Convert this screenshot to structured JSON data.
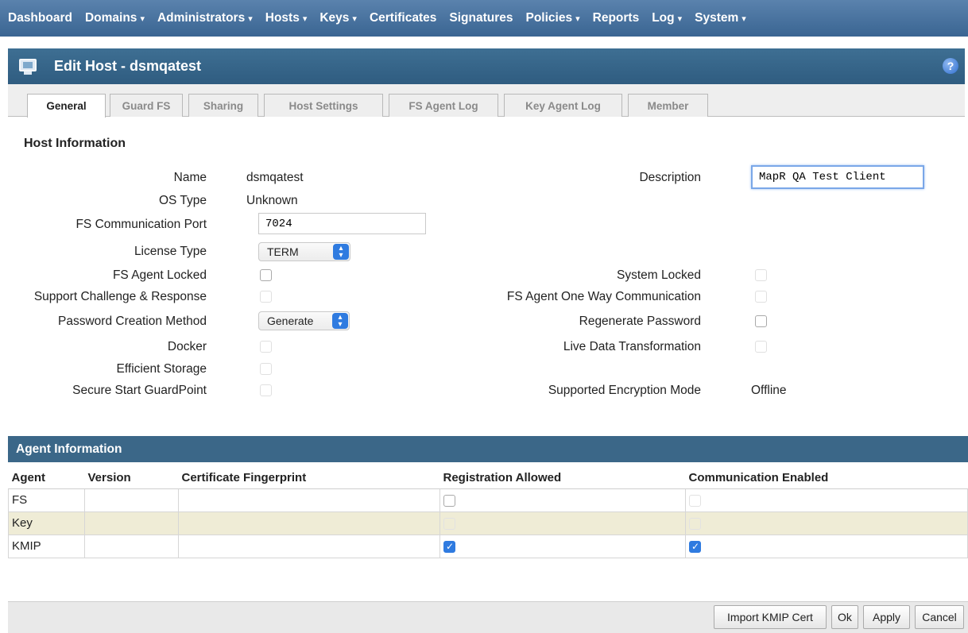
{
  "nav": [
    {
      "label": "Dashboard",
      "dropdown": false
    },
    {
      "label": "Domains",
      "dropdown": true
    },
    {
      "label": "Administrators",
      "dropdown": true
    },
    {
      "label": "Hosts",
      "dropdown": true
    },
    {
      "label": "Keys",
      "dropdown": true
    },
    {
      "label": "Certificates",
      "dropdown": false
    },
    {
      "label": "Signatures",
      "dropdown": false
    },
    {
      "label": "Policies",
      "dropdown": true
    },
    {
      "label": "Reports",
      "dropdown": false
    },
    {
      "label": "Log",
      "dropdown": true
    },
    {
      "label": "System",
      "dropdown": true
    }
  ],
  "caret": "▾",
  "title": "Edit Host - dsmqatest",
  "help_glyph": "?",
  "tabs": [
    "General",
    "Guard FS",
    "Sharing",
    "Host Settings",
    "FS Agent Log",
    "Key Agent Log",
    "Member"
  ],
  "host_info": {
    "section_title": "Host Information",
    "name_label": "Name",
    "name_value": "dsmqatest",
    "os_type_label": "OS Type",
    "os_type_value": "Unknown",
    "fs_port_label": "FS Communication Port",
    "fs_port_value": "7024",
    "license_type_label": "License Type",
    "license_type_value": "TERM",
    "fs_agent_locked_label": "FS Agent Locked",
    "support_challenge_label": "Support Challenge & Response",
    "password_method_label": "Password Creation Method",
    "password_method_value": "Generate",
    "docker_label": "Docker",
    "efficient_storage_label": "Efficient Storage",
    "secure_start_label": "Secure Start GuardPoint",
    "description_label": "Description",
    "description_value": "MapR QA Test Client",
    "system_locked_label": "System Locked",
    "one_way_label": "FS Agent One Way Communication",
    "regenerate_label": "Regenerate Password",
    "live_data_label": "Live Data Transformation",
    "encryption_mode_label": "Supported Encryption Mode",
    "encryption_mode_value": "Offline"
  },
  "agent_info": {
    "header": "Agent Information",
    "columns": [
      "Agent",
      "Version",
      "Certificate Fingerprint",
      "Registration Allowed",
      "Communication Enabled"
    ],
    "rows": [
      {
        "agent": "FS",
        "version": "",
        "fingerprint": "",
        "registration_allowed": false,
        "communication_enabled": false
      },
      {
        "agent": "Key",
        "version": "",
        "fingerprint": "",
        "registration_allowed": false,
        "communication_enabled": false
      },
      {
        "agent": "KMIP",
        "version": "",
        "fingerprint": "",
        "registration_allowed": true,
        "communication_enabled": true
      }
    ]
  },
  "buttons": {
    "import_kmip": "Import KMIP Cert",
    "ok": "Ok",
    "apply": "Apply",
    "cancel": "Cancel"
  }
}
